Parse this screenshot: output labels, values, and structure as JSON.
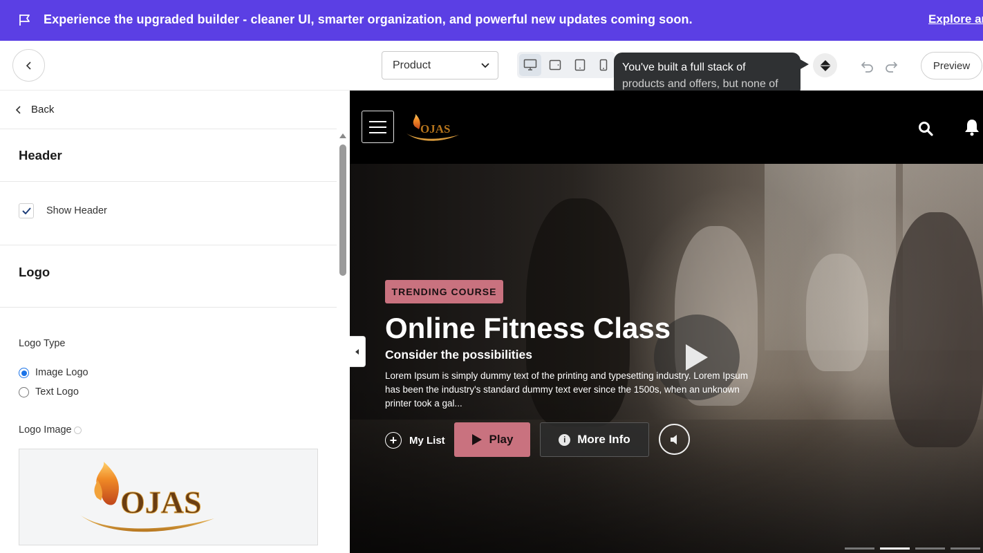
{
  "banner": {
    "message": "Experience the upgraded builder - cleaner UI, smarter organization, and powerful new updates coming soon.",
    "link": "Explore an",
    "icon": "flag-icon"
  },
  "toolbar": {
    "page_select": {
      "selected": "Product"
    },
    "devices": [
      "desktop-icon",
      "tablet-landscape-icon",
      "tablet-portrait-icon",
      "mobile-icon"
    ],
    "active_device": "desktop",
    "tooltip": {
      "line1": "You've built a full stack of",
      "line2": "products and offers, but none of"
    },
    "preview_label": "Preview"
  },
  "panel": {
    "back_label": "Back",
    "header_section": {
      "title": "Header"
    },
    "show_header": {
      "label": "Show Header",
      "checked": true
    },
    "logo_section": {
      "title": "Logo"
    },
    "logo_type": {
      "label": "Logo Type",
      "options": [
        {
          "label": "Image Logo",
          "selected": true
        },
        {
          "label": "Text Logo",
          "selected": false
        }
      ]
    },
    "logo_image": {
      "label": "Logo Image",
      "logo_text": "OJAS"
    }
  },
  "site": {
    "logo_text": "OJAS",
    "hero": {
      "badge": "TRENDING COURSE",
      "title": "Online Fitness Class",
      "subtitle": "Consider the possibilities",
      "description": "Lorem Ipsum is simply dummy text of the printing and typesetting industry. Lorem Ipsum has been the industry's standard dummy text ever since the 1500s, when an unknown printer took a gal...",
      "my_list_label": "My List",
      "play_label": "Play",
      "more_info_label": "More Info"
    },
    "slides": {
      "count": 4,
      "active": 2
    }
  },
  "colors": {
    "banner": "#5b3fe4",
    "accent": "#c9727f",
    "radio_active": "#1a73e8"
  }
}
